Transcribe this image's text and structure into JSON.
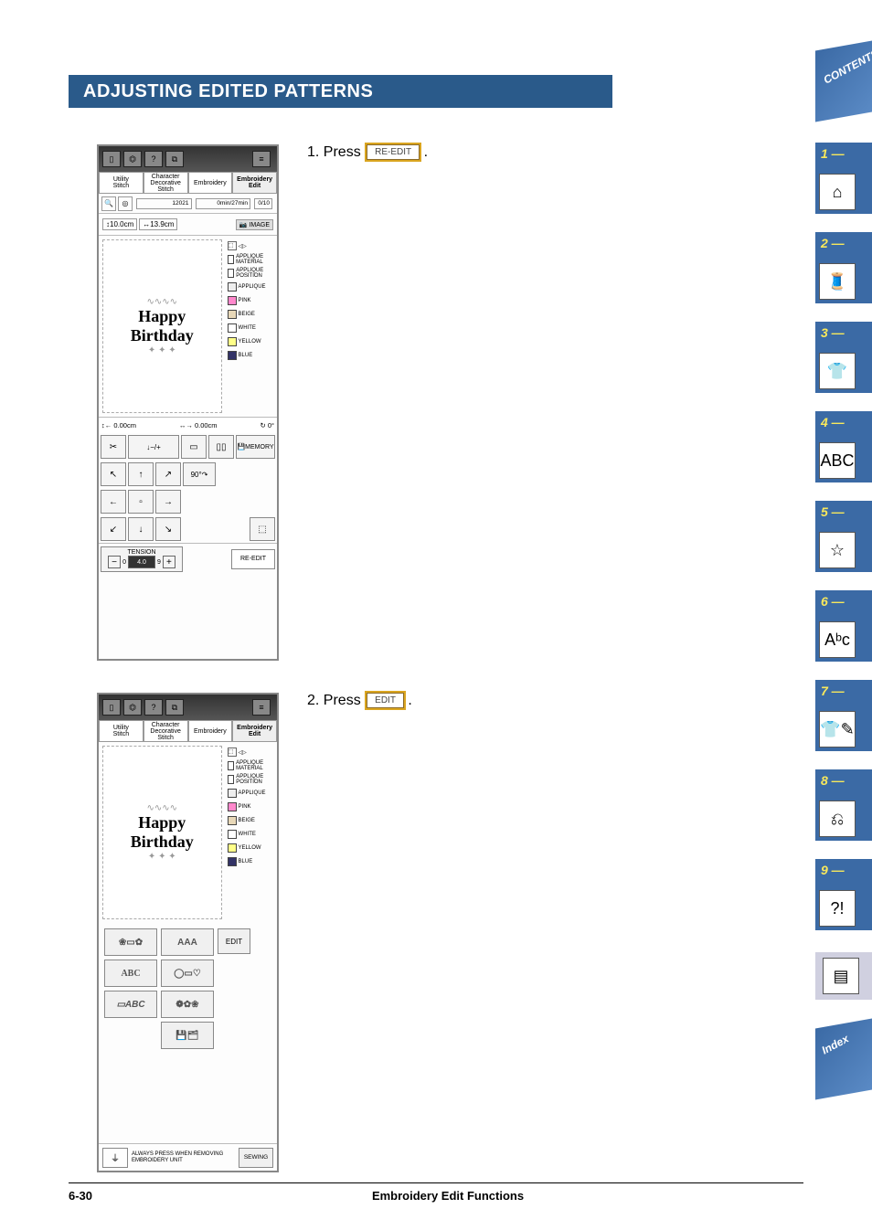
{
  "page": {
    "title": "ADJUSTING EDITED PATTERNS",
    "footer_page": "6-30",
    "footer_section": "Embroidery Edit Functions"
  },
  "instructions": {
    "step1_num": "1.",
    "step1_text": "Press",
    "step1_button": "RE-EDIT",
    "step1_suffix": ".",
    "step2_num": "2.",
    "step2_text": "Press",
    "step2_button": "EDIT",
    "step2_suffix": "."
  },
  "screenshot1": {
    "tabs": {
      "t1_l1": "Utility",
      "t1_l2": "Stitch",
      "t2_l1": "Character",
      "t2_l2": "Decorative",
      "t2_l3": "Stitch",
      "t3": "Embroidery",
      "t4_l1": "Embroidery",
      "t4_l2": "Edit"
    },
    "status": {
      "count": "12021",
      "time_a": "0min",
      "time_b": "27min",
      "right_a": "0",
      "right_b": "10"
    },
    "size": {
      "h": "10.0cm",
      "w": "13.9cm",
      "image_btn": "IMAGE"
    },
    "preview": {
      "line1": "Happy",
      "line2": "Birthday"
    },
    "colors": [
      {
        "name": "APPLIQUE MATERIAL"
      },
      {
        "name": "APPLIQUE POSITION"
      },
      {
        "name": "APPLIQUE"
      },
      {
        "name": "PINK"
      },
      {
        "name": "BEIGE"
      },
      {
        "name": "WHITE"
      },
      {
        "name": "YELLOW"
      },
      {
        "name": "BLUE"
      }
    ],
    "position": {
      "v": "0.00cm",
      "h": "0.00cm",
      "rot": "0°"
    },
    "buttons": {
      "memory": "MEMORY",
      "ninety": "90°",
      "tension_label": "TENSION",
      "tension_low": "0",
      "tension_val": "4.0",
      "tension_high": "9",
      "re_edit": "RE-EDIT"
    }
  },
  "screenshot2": {
    "tabs": {
      "t1_l1": "Utility",
      "t1_l2": "Stitch",
      "t2_l1": "Character",
      "t2_l2": "Decorative",
      "t2_l3": "Stitch",
      "t3": "Embroidery",
      "t4_l1": "Embroidery",
      "t4_l2": "Edit"
    },
    "preview": {
      "line1": "Happy",
      "line2": "Birthday"
    },
    "colors": [
      {
        "name": "APPLIQUE MATERIAL"
      },
      {
        "name": "APPLIQUE POSITION"
      },
      {
        "name": "APPLIQUE"
      },
      {
        "name": "PINK"
      },
      {
        "name": "BEIGE"
      },
      {
        "name": "WHITE"
      },
      {
        "name": "YELLOW"
      },
      {
        "name": "BLUE"
      }
    ],
    "menu": {
      "aaa": "AAA",
      "abc": "ABC",
      "abc_script": "ABC",
      "edit": "EDIT"
    },
    "bottom": {
      "text": "ALWAYS PRESS WHEN REMOVING EMBROIDERY UNIT",
      "sewing": "SEWING"
    }
  },
  "side_tabs": {
    "contents": "CONTENTS",
    "index": "Index",
    "n1": "1 —",
    "n2": "2 —",
    "n3": "3 —",
    "n4": "4 —",
    "n5": "5 —",
    "n6": "6 —",
    "n7": "7 —",
    "n8": "8 —",
    "n9": "9 —"
  }
}
